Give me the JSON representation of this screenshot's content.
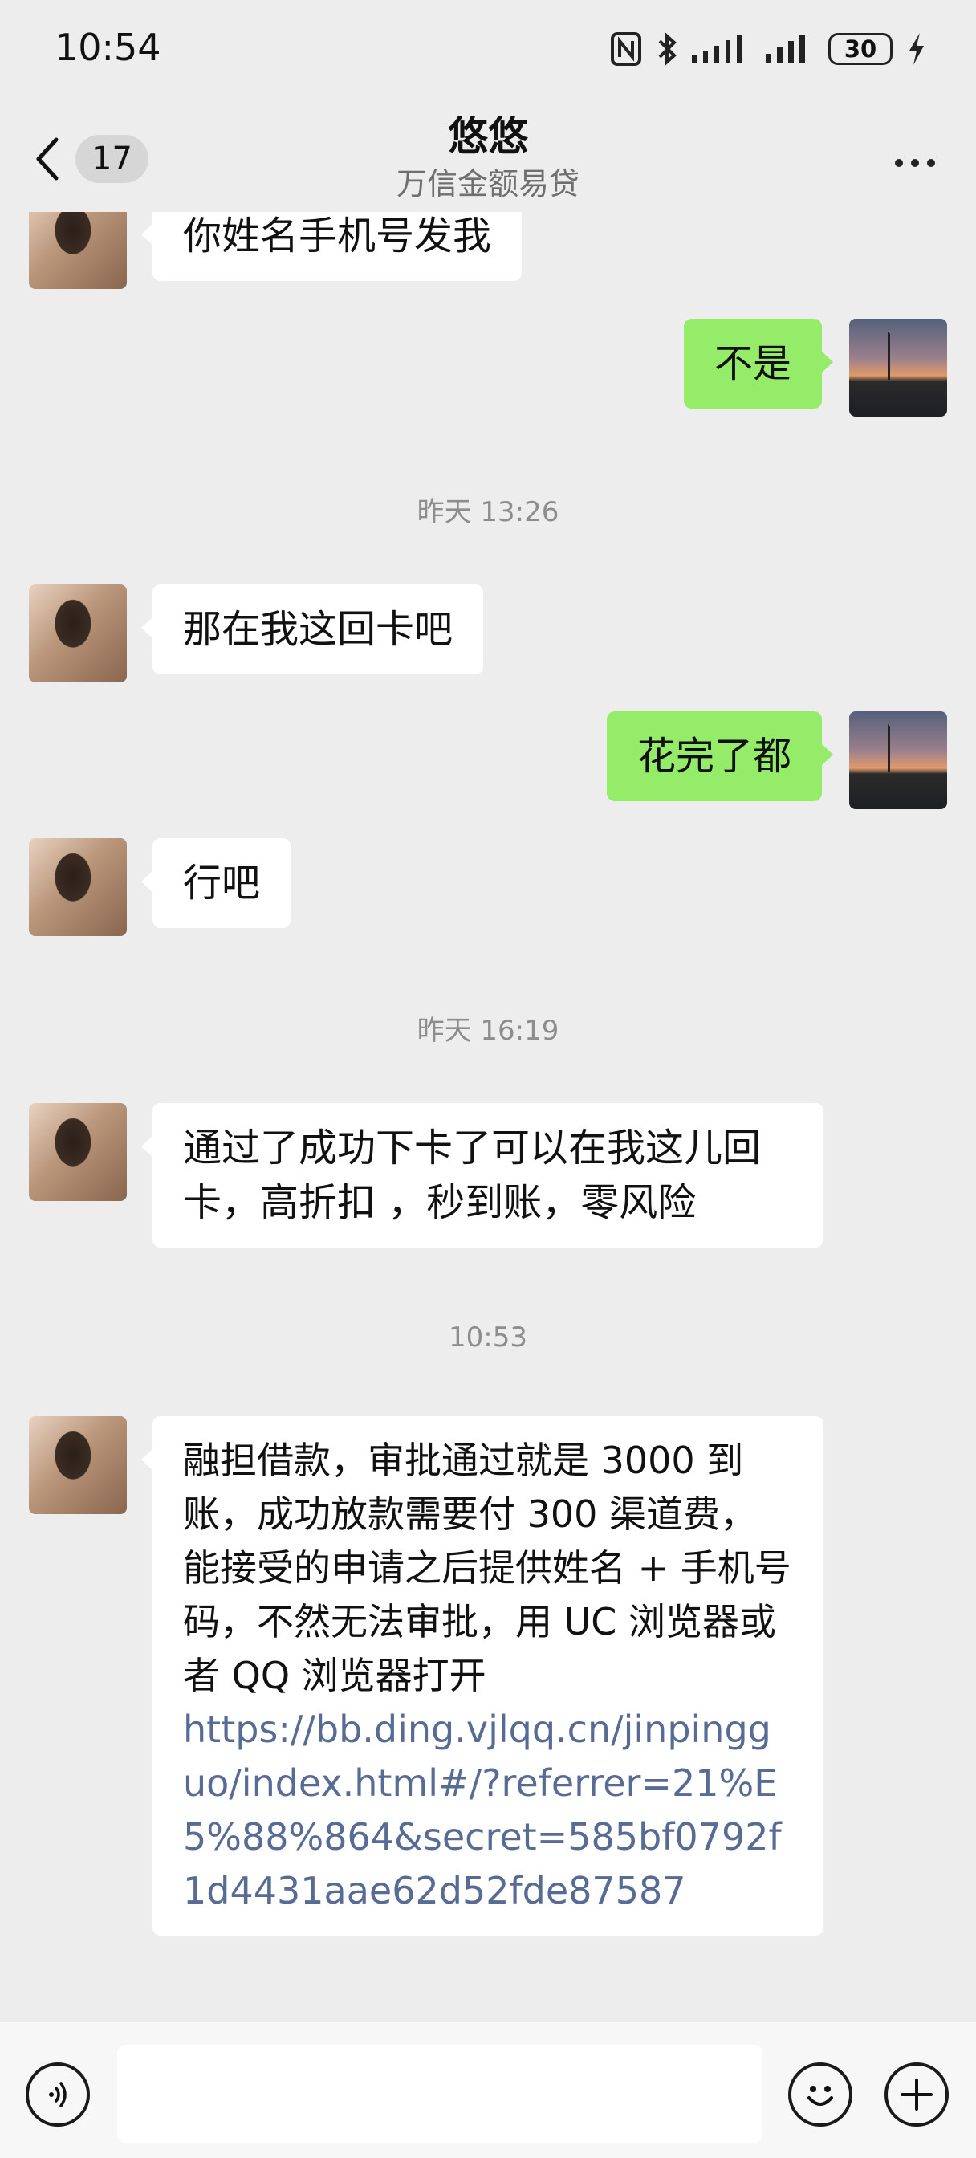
{
  "status_bar": {
    "time": "10:54",
    "battery": "30",
    "icons": [
      "nfc-icon",
      "bluetooth-icon",
      "signal-icon",
      "signal-icon",
      "battery-icon",
      "charging-icon"
    ]
  },
  "header": {
    "unread_count": "17",
    "title": "悠悠",
    "subtitle": "万信金额易贷",
    "icons": [
      "back-chevron-icon",
      "more-icon"
    ]
  },
  "messages": [
    {
      "type": "text",
      "from": "contact",
      "text": "你姓名手机号发我"
    },
    {
      "type": "text",
      "from": "me",
      "text": "不是"
    },
    {
      "type": "time",
      "text": "昨天 13:26"
    },
    {
      "type": "text",
      "from": "contact",
      "text": "那在我这回卡吧"
    },
    {
      "type": "text",
      "from": "me",
      "text": "花完了都"
    },
    {
      "type": "text",
      "from": "contact",
      "text": "行吧"
    },
    {
      "type": "time",
      "text": "昨天 16:19"
    },
    {
      "type": "text",
      "from": "contact",
      "text": "通过了成功下卡了可以在我这儿回卡，高折扣 ，秒到账，零风险"
    },
    {
      "type": "time",
      "text": "10:53"
    },
    {
      "type": "text",
      "from": "contact",
      "text": "融担借款，审批通过就是 3000 到账，成功放款需要付 300 渠道费，能接受的申请之后提供姓名 + 手机号码，不然无法审批，用 UC 浏览器或者 QQ 浏览器打开",
      "link": "https://bb.ding.vjlqq.cn/jinpingguo/index.html#/?referrer=21%E5%88%864&secret=585bf0792f1d4431aae62d52fde87587"
    }
  ],
  "input_bar": {
    "icons": [
      "voice-icon",
      "emoji-icon",
      "plus-icon"
    ],
    "draft": ""
  },
  "colors": {
    "background": "#ededed",
    "outgoing_bubble": "#95ec69",
    "incoming_bubble": "#ffffff",
    "link": "#576b95"
  }
}
